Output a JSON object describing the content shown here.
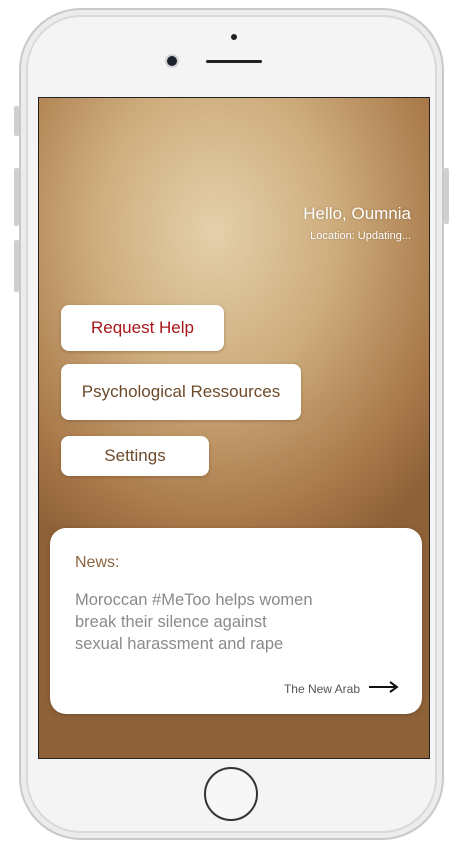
{
  "header": {
    "greeting": "Hello, Oumnia",
    "location": "Location: Updating..."
  },
  "menu": {
    "request_help": "Request Help",
    "psychological_resources": "Psychological Ressources",
    "settings": "Settings"
  },
  "news": {
    "title": "News:",
    "headline": "Moroccan #MeToo helps women break their silence against sexual harassment and rape",
    "source": "The New Arab",
    "arrow_icon": "arrow-right-icon"
  },
  "colors": {
    "accent_red": "#a8171b",
    "brand_brown": "#6e4a2a",
    "news_title": "#8a6540"
  }
}
